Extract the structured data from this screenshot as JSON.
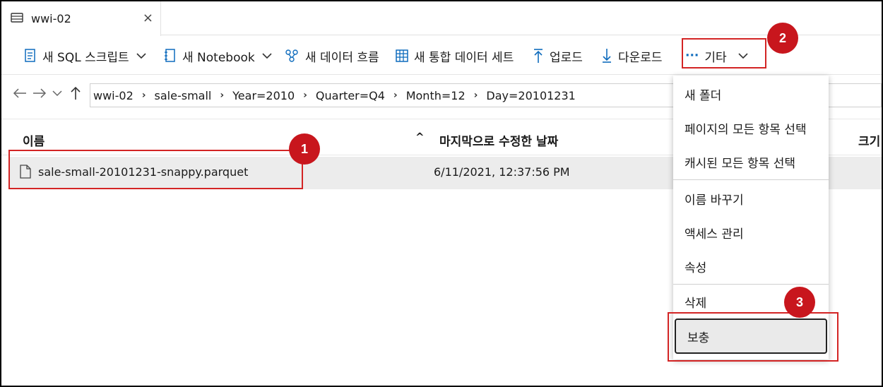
{
  "tab": {
    "title": "wwi-02",
    "close": "×"
  },
  "toolbar": {
    "new_sql_script": "새 SQL 스크립트",
    "new_notebook": "새 Notebook",
    "new_dataflow": "새 데이터 흐름",
    "new_integration_dataset": "새 통합 데이터 세트",
    "upload": "업로드",
    "download": "다운로드",
    "more_glyph": "···",
    "more": "기타"
  },
  "breadcrumb": [
    "wwi-02",
    "sale-small",
    "Year=2010",
    "Quarter=Q4",
    "Month=12",
    "Day=20101231"
  ],
  "columns": {
    "name": "이름",
    "sort_arrow": "^",
    "modified": "마지막으로 수정한 날짜",
    "size": "크기"
  },
  "files": [
    {
      "name": "sale-small-20101231-snappy.parquet",
      "modified": "6/11/2021, 12:37:56 PM"
    }
  ],
  "menu": {
    "items": [
      "새 폴더",
      "페이지의 모든 항목 선택",
      "캐시된 모든 항목 선택",
      "이름 바꾸기",
      "액세스 관리",
      "속성",
      "삭제",
      "보충"
    ],
    "active_item": "보충"
  },
  "callouts": [
    "1",
    "2",
    "3"
  ],
  "colors": {
    "accent": "#0f6cbd",
    "highlight": "#d32424",
    "badge": "#c8161d"
  }
}
